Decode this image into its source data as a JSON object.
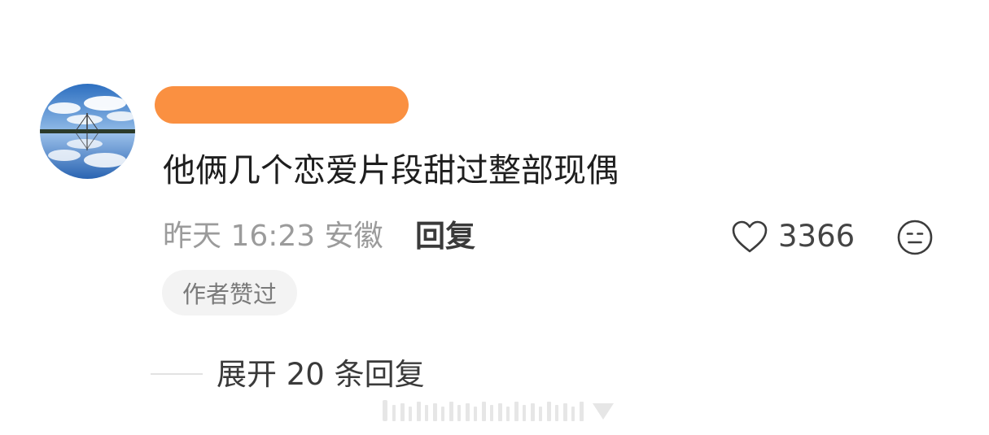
{
  "comment": {
    "avatar_icon": "avatar-landscape-reflection",
    "username": "",
    "text": "他俩几个恋爱片段甜过整部现偶",
    "time_location": "昨天 16:23 安徽",
    "reply_label": "回复",
    "like_count": "3366",
    "like_icon": "heart-outline-icon",
    "dislike_icon": "meh-face-icon",
    "badge": "作者赞过",
    "expand_label": "展开 20 条回复"
  },
  "colors": {
    "redaction": "#fa9041",
    "primary_text": "#1e1e1e",
    "secondary_text": "#9b9b9b",
    "badge_bg": "#f3f3f3"
  }
}
